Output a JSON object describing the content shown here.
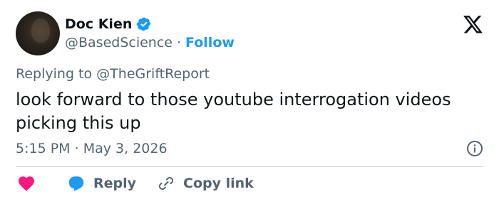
{
  "author": {
    "name": "Doc Kien",
    "handle": "@BasedScience",
    "separator": "·",
    "follow_label": "Follow",
    "verified": true
  },
  "reply_context": {
    "prefix": "Replying to",
    "mention": "@TheGriftReport"
  },
  "tweet": {
    "text": "look forward to those youtube interrogation videos picking this up",
    "time": "5:15 PM",
    "separator": "·",
    "date": "May 3, 2026"
  },
  "actions": {
    "reply_label": "Reply",
    "copy_link_label": "Copy link"
  },
  "colors": {
    "accent": "#1d9bf0",
    "like": "#f91880",
    "secondary_text": "#536471",
    "primary_text": "#0f1419"
  },
  "icons": [
    "verified-badge-icon",
    "x-logo-icon",
    "info-icon",
    "heart-icon",
    "reply-bubble-icon",
    "link-icon"
  ]
}
